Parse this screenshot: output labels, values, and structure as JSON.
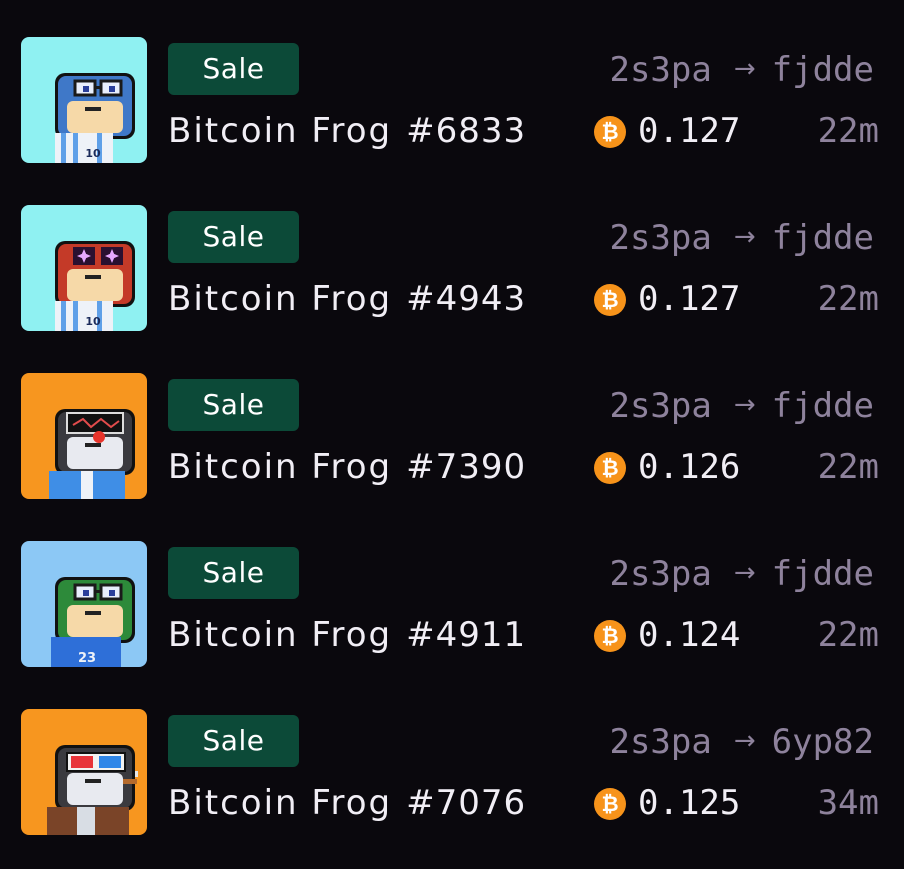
{
  "activity": [
    {
      "type_label": "Sale",
      "from": "2s3pa",
      "to": "fjdde",
      "collection": "Bitcoin Frog",
      "number": "#6833",
      "price": "0.127",
      "time": "22m",
      "currency_icon": "bitcoin-icon",
      "bg_color": "#8ff1f2",
      "skin_color": "#3f78c8",
      "eyes": "glasses",
      "shirt": "stripe",
      "shirt_number": "10"
    },
    {
      "type_label": "Sale",
      "from": "2s3pa",
      "to": "fjdde",
      "collection": "Bitcoin Frog",
      "number": "#4943",
      "price": "0.127",
      "time": "22m",
      "currency_icon": "bitcoin-icon",
      "bg_color": "#8ff1f2",
      "skin_color": "#c43a28",
      "eyes": "sparkle",
      "shirt": "stripe",
      "shirt_number": "10"
    },
    {
      "type_label": "Sale",
      "from": "2s3pa",
      "to": "fjdde",
      "collection": "Bitcoin Frog",
      "number": "#7390",
      "price": "0.126",
      "time": "22m",
      "currency_icon": "bitcoin-icon",
      "bg_color": "#f7961f",
      "skin_color": "#3a3a3f",
      "eyes": "visor",
      "shirt": "blue",
      "shirt_number": ""
    },
    {
      "type_label": "Sale",
      "from": "2s3pa",
      "to": "fjdde",
      "collection": "Bitcoin Frog",
      "number": "#4911",
      "price": "0.124",
      "time": "22m",
      "currency_icon": "bitcoin-icon",
      "bg_color": "#8cc8f5",
      "skin_color": "#2d8a3a",
      "eyes": "glasses",
      "shirt": "jersey",
      "shirt_number": "23"
    },
    {
      "type_label": "Sale",
      "from": "2s3pa",
      "to": "6yp82",
      "collection": "Bitcoin Frog",
      "number": "#7076",
      "price": "0.125",
      "time": "34m",
      "currency_icon": "bitcoin-icon",
      "bg_color": "#f7961f",
      "skin_color": "#3a3a3f",
      "eyes": "3d",
      "shirt": "jacket",
      "shirt_number": ""
    }
  ],
  "arrow_glyph": "→",
  "currency_glyph": "₿"
}
